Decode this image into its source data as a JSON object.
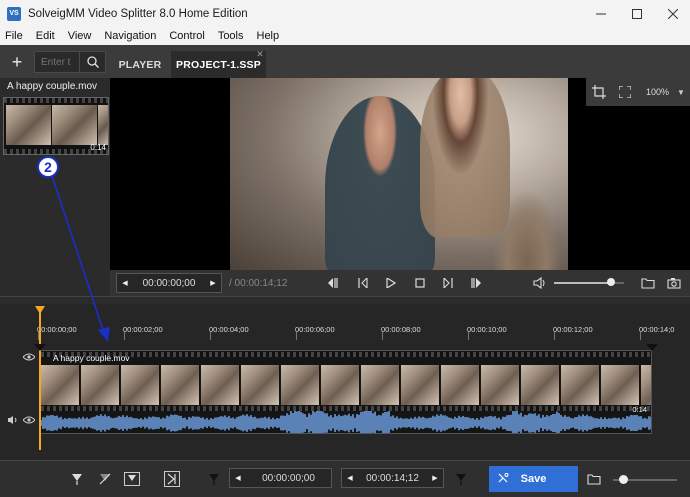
{
  "window": {
    "title": "SolveigMM Video Splitter 8.0 Home Edition",
    "app_icon_text": "VS"
  },
  "menu": [
    "File",
    "Edit",
    "View",
    "Navigation",
    "Control",
    "Tools",
    "Help"
  ],
  "toolbar": {
    "search_placeholder": "Enter t"
  },
  "tabs": [
    {
      "label": "PLAYER",
      "active": false
    },
    {
      "label": "PROJECT-1.SSP",
      "active": true
    }
  ],
  "media_panel": {
    "file_name": "A happy couple.mov",
    "thumb_duration": "0:14"
  },
  "preview": {
    "zoom": "100%"
  },
  "player": {
    "current_time": "00:00:00;00",
    "total_duration": "/ 00:00:14;12",
    "volume": 0.82
  },
  "timeline": {
    "ruler_labels": [
      "00:00:00;00",
      "00:00:02;00",
      "00:00:04;00",
      "00:00:06;00",
      "00:00:08;00",
      "00:00:10;00",
      "00:00:12;00",
      "00:00:14;0"
    ],
    "track_title": "A happy couple.mov",
    "track_duration": "0:14"
  },
  "bottom": {
    "start_time": "00:00:00;00",
    "end_time": "00:00:14;12",
    "save_label": "Save",
    "zoom_level": 0.1
  },
  "annotation": {
    "step": "2"
  },
  "colors": {
    "accent": "#2f6fd6",
    "playhead": "#f5a623",
    "waveform": "#6c9ee0",
    "annotation": "#1a2fc8"
  }
}
